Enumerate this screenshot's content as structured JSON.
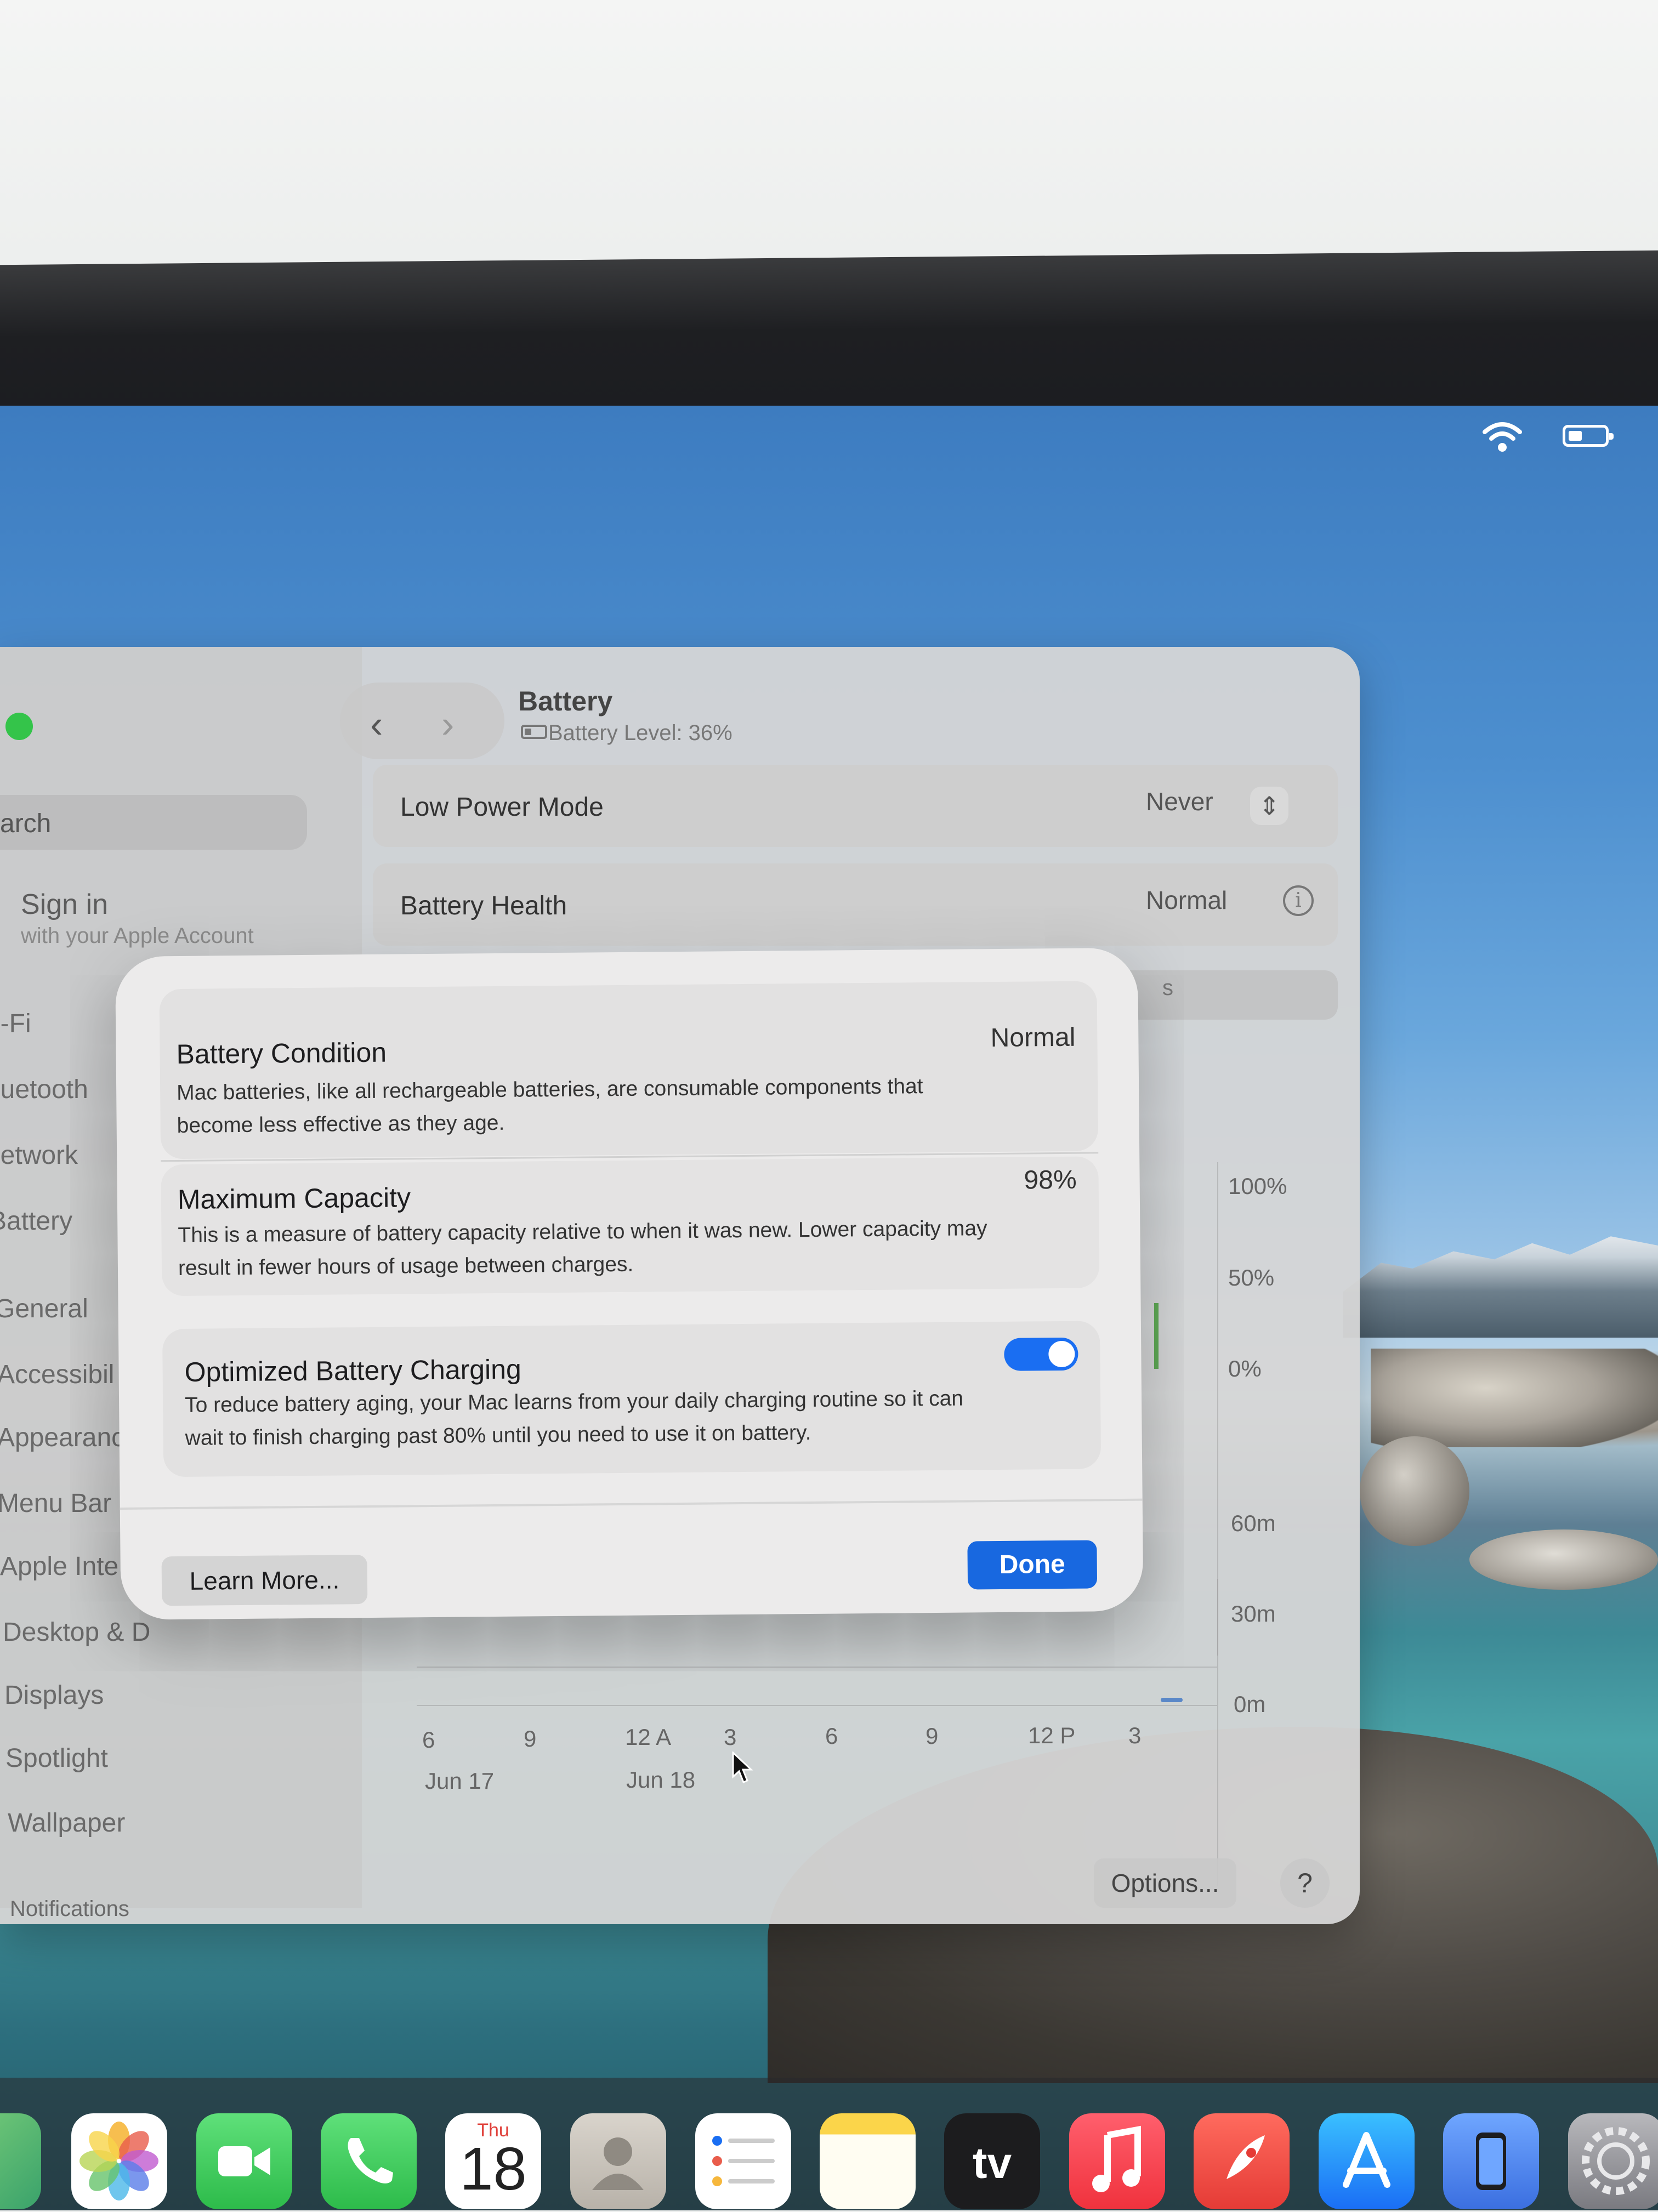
{
  "window": {
    "title": "Battery",
    "subtitle": "Battery Level: 36%"
  },
  "sidebar": {
    "search_placeholder": "arch",
    "sign_in_title": "Sign in",
    "sign_in_subtitle": "with your Apple Account",
    "items": [
      "i-Fi",
      "luetooth",
      "letwork",
      "Battery",
      "General",
      "Accessibil",
      "Appearanc",
      "Menu Bar",
      "Apple Inte",
      "Desktop & D",
      "Displays",
      "Spotlight",
      "Wallpaper",
      "Notifications"
    ]
  },
  "settings_rows": {
    "low_power_mode": {
      "label": "Low Power Mode",
      "value": "Never"
    },
    "battery_health": {
      "label": "Battery Health",
      "value": "Normal"
    },
    "row3_peek": "s"
  },
  "usage_chart": {
    "level_ticks": [
      "100%",
      "50%",
      "0%"
    ],
    "screen_ticks": [
      "60m",
      "30m",
      "0m"
    ],
    "time_ticks": [
      "6",
      "9",
      "12 A",
      "3",
      "6",
      "9",
      "12 P",
      "3"
    ],
    "date_labels": [
      "Jun 17",
      "Jun 18"
    ]
  },
  "sheet": {
    "battery_condition": {
      "title": "Battery Condition",
      "value": "Normal",
      "description": "Mac batteries, like all rechargeable batteries, are consumable components that become less effective as they age."
    },
    "maximum_capacity": {
      "title": "Maximum Capacity",
      "value": "98%",
      "description": "This is a measure of battery capacity relative to when it was new. Lower capacity may result in fewer hours of usage between charges."
    },
    "optimized_charging": {
      "title": "Optimized Battery Charging",
      "enabled": true,
      "description": "To reduce battery aging, your Mac learns from your daily charging routine so it can wait to finish charging past 80% until you need to use it on battery."
    },
    "learn_more_label": "Learn More...",
    "done_label": "Done"
  },
  "buttons": {
    "options_label": "Options...",
    "help_label": "?"
  },
  "dock": {
    "calendar_day": "Thu",
    "calendar_date": "18",
    "tv_label": "tv",
    "icons": [
      "maps-icon",
      "photos-icon",
      "facetime-icon",
      "phone-icon",
      "calendar-icon",
      "contacts-icon",
      "reminders-icon",
      "notes-icon",
      "apple-tv-icon",
      "music-icon",
      "launchpad-icon",
      "app-store-icon",
      "iphone-mirroring-icon",
      "system-settings-icon"
    ]
  },
  "colors": {
    "accent": "#1868e0",
    "toggle_on": "#1a6ef2",
    "traffic_green": "#34c44a"
  }
}
